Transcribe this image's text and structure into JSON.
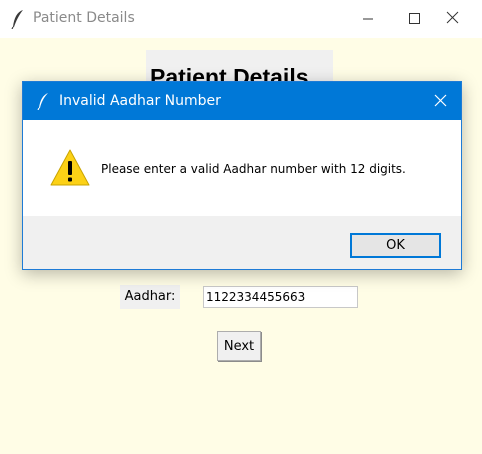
{
  "window": {
    "title": "Patient Details",
    "icon": "feather-icon",
    "controls": [
      "minimize-icon",
      "maximize-icon",
      "close-icon"
    ]
  },
  "main": {
    "header": "Patient Details",
    "aadhar_label": "Aadhar:",
    "aadhar_value": "1122334455663",
    "next_label": "Next"
  },
  "dialog": {
    "title": "Invalid Aadhar Number",
    "icon": "warning-icon",
    "message": "Please enter a valid Aadhar number with 12 digits.",
    "ok_label": "OK"
  },
  "colors": {
    "background": "#fffde6",
    "dialog_titlebar": "#0078d7",
    "warning": "#fcd116"
  }
}
